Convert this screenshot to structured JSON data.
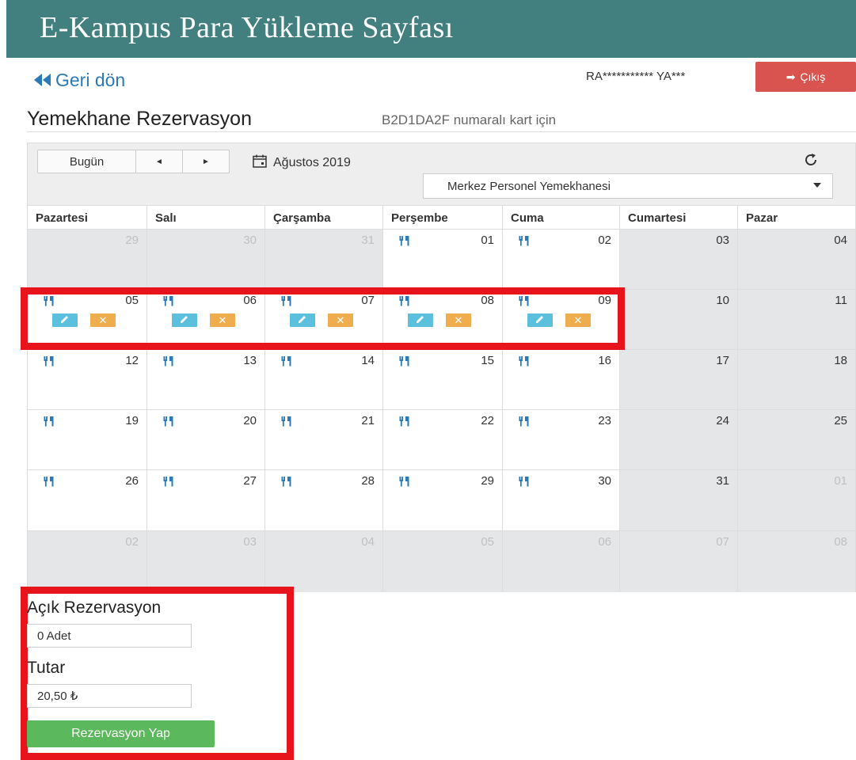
{
  "header": {
    "title": "E-Kampus Para Yükleme Sayfası"
  },
  "nav": {
    "back_label": "Geri dön",
    "user_name": "RA*********** YA***",
    "logout_label": "Çıkış"
  },
  "page": {
    "title": "Yemekhane Rezervasyon",
    "subtitle": "B2D1DA2F numaralı kart için"
  },
  "calendar": {
    "today_label": "Bugün",
    "prev_label": "◄",
    "next_label": "►",
    "month_label": "Ağustos 2019",
    "cafeteria_selected": "Merkez Personel Yemekhanesi",
    "weekdays": [
      "Pazartesi",
      "Salı",
      "Çarşamba",
      "Perşembe",
      "Cuma",
      "Cumartesi",
      "Pazar"
    ],
    "weeks": [
      [
        "29",
        "30",
        "31",
        "01",
        "02",
        "03",
        "04"
      ],
      [
        "05",
        "06",
        "07",
        "08",
        "09",
        "10",
        "11"
      ],
      [
        "12",
        "13",
        "14",
        "15",
        "16",
        "17",
        "18"
      ],
      [
        "19",
        "20",
        "21",
        "22",
        "23",
        "24",
        "25"
      ],
      [
        "26",
        "27",
        "28",
        "29",
        "30",
        "31",
        "01"
      ],
      [
        "02",
        "03",
        "04",
        "05",
        "06",
        "07",
        "08"
      ]
    ],
    "reserved_days": [
      "05",
      "06",
      "07",
      "08",
      "09"
    ],
    "icons": {
      "meal": "fork-knife-icon",
      "edit": "pencil-icon",
      "cancel": "x-icon",
      "month": "calendar-icon",
      "refresh": "refresh-icon"
    }
  },
  "reservation": {
    "open_label": "Açık Rezervasyon",
    "open_count": "0 Adet",
    "amount_label": "Tutar",
    "amount_value": "20,50 ₺",
    "submit_label": "Rezervasyon Yap"
  },
  "colors": {
    "banner": "#41807f",
    "link": "#2a7ab8",
    "logout": "#d9534f",
    "edit_button": "#5bc0de",
    "cancel_button": "#f0ad4e",
    "submit_button": "#5cb85c",
    "highlight": "#e8141c",
    "meal_icon": "#2a7ab8"
  }
}
